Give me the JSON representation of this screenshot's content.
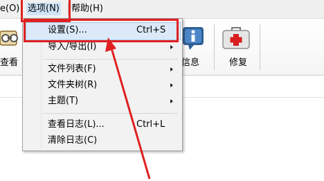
{
  "menubar": {
    "items": [
      {
        "label": "e(O)"
      },
      {
        "label": "选项(N)"
      },
      {
        "label": "帮助(H)"
      }
    ]
  },
  "toolbar": {
    "buttons": [
      {
        "label": "查看",
        "icon": "view-icon"
      },
      {
        "label": "信息",
        "icon": "info-icon"
      },
      {
        "label": "修复",
        "icon": "repair-icon"
      }
    ]
  },
  "dropdown": {
    "items": [
      {
        "label": "设置(S)...",
        "shortcut": "Ctrl+S",
        "highlighted": true
      },
      {
        "label": "导入/导出(I)",
        "submenu": true
      },
      {
        "label": "文件列表(F)",
        "submenu": true
      },
      {
        "label": "文件夹树(R)",
        "submenu": true
      },
      {
        "label": "主题(T)",
        "submenu": true
      },
      {
        "label": "查看日志(L)...",
        "shortcut": "Ctrl+L"
      },
      {
        "label": "清除日志(C)"
      }
    ]
  },
  "colors": {
    "annotation": "#e02020",
    "highlight": "#dbe9f8",
    "menu_bg": "#f2f2f2"
  }
}
